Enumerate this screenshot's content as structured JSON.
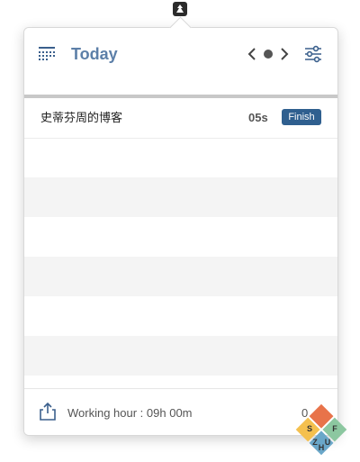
{
  "menubar": {
    "icon": "app-icon"
  },
  "header": {
    "title": "Today",
    "calendar_icon": "calendar-grid-icon",
    "prev_icon": "chevron-left-icon",
    "today_icon": "dot-icon",
    "next_icon": "chevron-right-icon",
    "filter_icon": "sliders-icon",
    "title_color": "#5c7fa8"
  },
  "tasks": [
    {
      "title": "史蒂芬周的博客",
      "time": "05s",
      "action_label": "Finish"
    }
  ],
  "footer": {
    "share_icon": "share-icon",
    "working_hour": "Working hour : 09h 00m",
    "time_partial": "0"
  },
  "watermark": {
    "letters": [
      "S",
      "F",
      "Z",
      "H",
      "U"
    ]
  },
  "colors": {
    "accent": "#2f5f8f",
    "stripe": "#f4f4f4",
    "rule": "#c8c8c8"
  }
}
